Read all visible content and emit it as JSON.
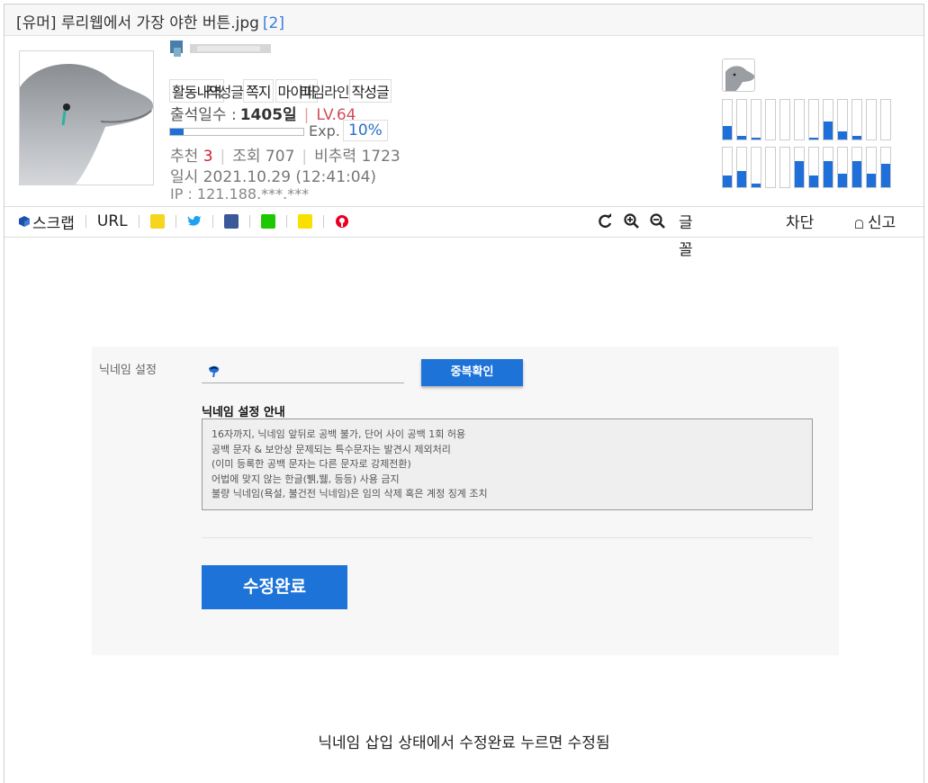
{
  "title": {
    "text": "[유머] 루리웹에서 가장 야한 버튼.jpg",
    "count": "[2]"
  },
  "profile": {
    "menu_items": [
      "활동내역",
      "작성글",
      "쪽지",
      "마이피",
      "타임라인",
      "작성글"
    ],
    "attendance_label": "출석일수 :",
    "attendance_days": "1405일",
    "level": "LV.64",
    "exp_label": "Exp.",
    "exp_percent": "10%",
    "exp_fraction": 0.1,
    "recommend_label": "추천",
    "recommend_value": "3",
    "views": "조회 707",
    "nonrec": "비추력 1723",
    "date": "일시 2021.10.29 (12:41:04)",
    "ip": "IP : 121.188.***.***"
  },
  "activity_levels": {
    "row1": [
      0.35,
      0.1,
      0.05,
      0,
      0,
      0,
      0.05,
      0.45,
      0.2,
      0.08,
      0,
      0
    ],
    "row2": [
      0.3,
      0.4,
      0.1,
      0,
      0,
      0.65,
      0.3,
      0.65,
      0.35,
      0.65,
      0.35,
      0.6
    ]
  },
  "share": {
    "scrap": "스크랩",
    "url": "URL",
    "icons": [
      "kakaostory-icon",
      "twitter-icon",
      "facebook-icon",
      "naver-icon",
      "kakaotalk-icon",
      "pinterest-icon"
    ]
  },
  "tools": {
    "font": "글꼴",
    "block": "차단",
    "report": "신고"
  },
  "form": {
    "nick_label": "닉네임 설정",
    "dup_button": "중복확인",
    "guide_title": "닉네임 설정 안내",
    "guide_lines": [
      "16자까지, 닉네임 앞뒤로 공백 불가, 단어 사이 공백 1회 허용",
      "공백 문자 & 보안상 문제되는 특수문자는 발견시 제외처리",
      "(이미 등록한 공백 문자는 다른 문자로 강제전환)",
      "어법에 맞지 않는 한글(쀍,뛣, 등등) 사용 금지",
      "불량 닉네임(욕설, 불건전 닉네임)은 임의 삭제 혹은 계정 징계 조치"
    ],
    "submit_button": "수정완료"
  },
  "caption": "닉네임 삽입 상태에서 수정완료 누르면 수정됨",
  "colors": {
    "accent": "#1e73d9",
    "level": "#d0505a",
    "recommend": "#d02030"
  }
}
